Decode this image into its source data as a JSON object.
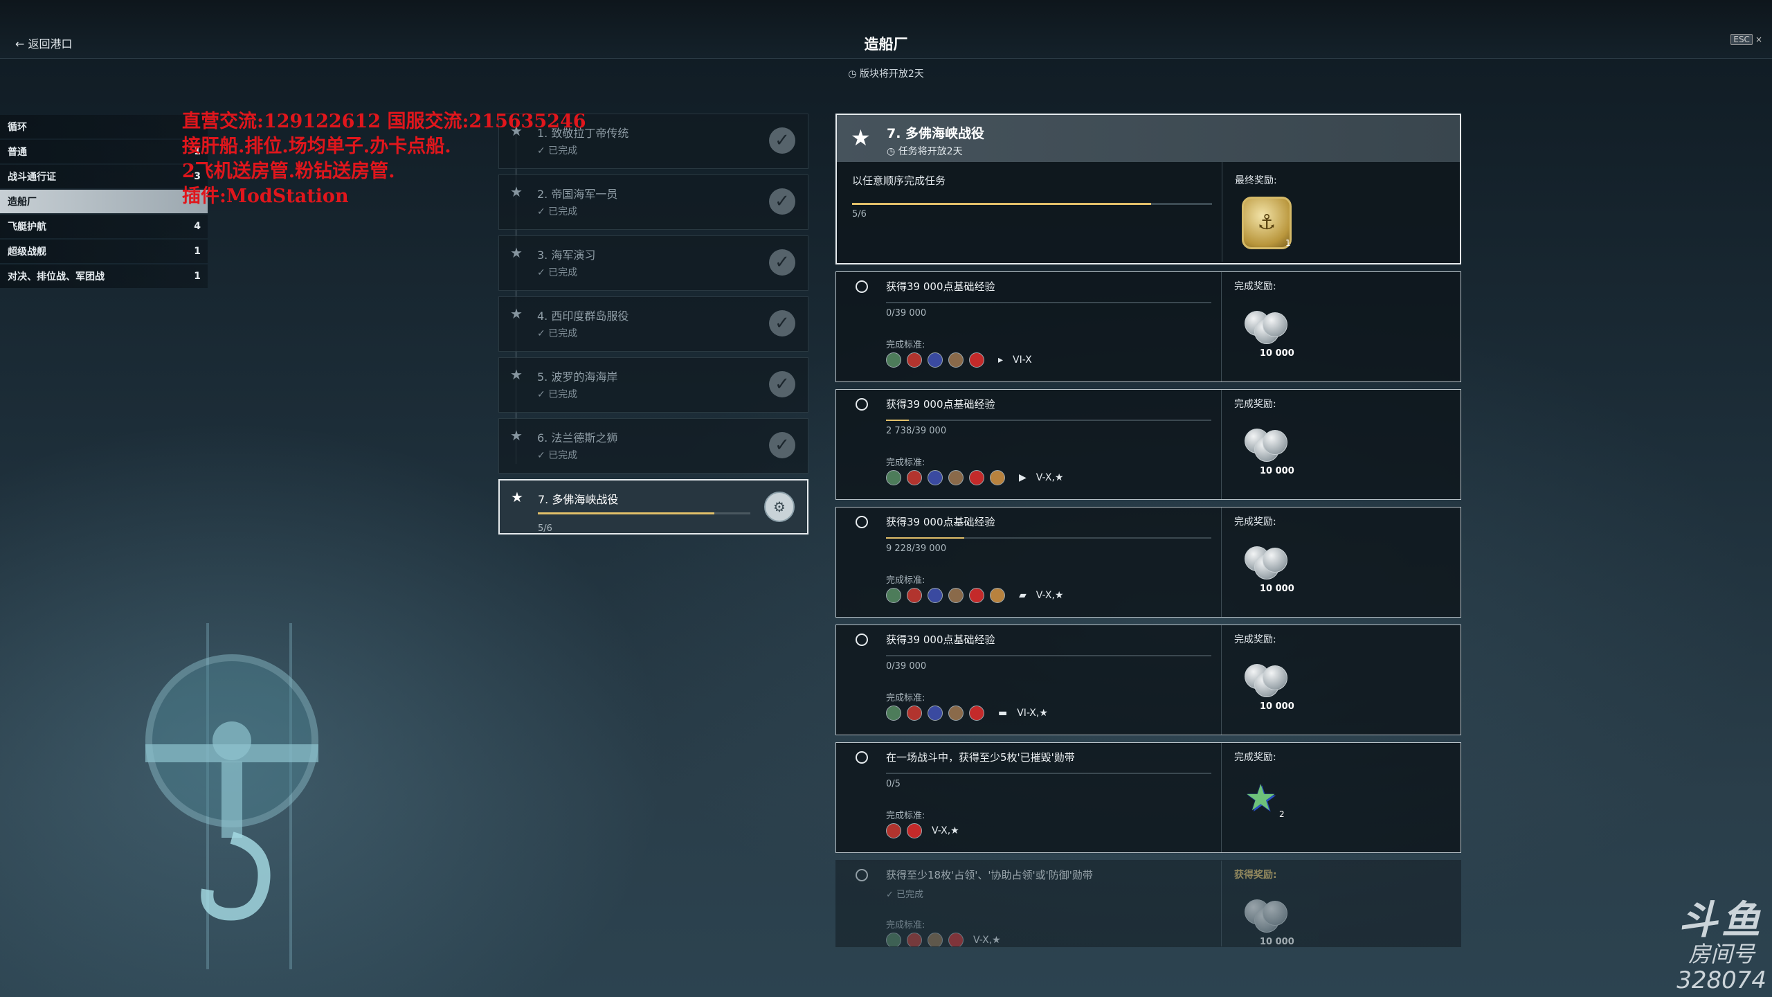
{
  "header": {
    "back_label": "← 返回港口",
    "title": "造船厂",
    "esc_key": "ESC",
    "close": "×",
    "timer": "◷ 版块将开放2天"
  },
  "sidebar": {
    "items": [
      {
        "label": "循环",
        "count": ""
      },
      {
        "label": "普通",
        "count": "1"
      },
      {
        "label": "战斗通行证",
        "count": "3"
      },
      {
        "label": "造船厂",
        "count": ""
      },
      {
        "label": "飞艇护航",
        "count": "4"
      },
      {
        "label": "超级战舰",
        "count": "1"
      },
      {
        "label": "对决、排位战、军团战",
        "count": "1"
      }
    ]
  },
  "overlay_text": {
    "line1": "直营交流:129122612 国服交流:215635246",
    "line2": "接肝船.排位.场均单子.办卡点船.",
    "line3": "2飞机送房管.粉钻送房管.",
    "line4": "插件:ModStation"
  },
  "stages": [
    {
      "name": "1. 致敬拉丁帝传统",
      "status": "✓ 已完成"
    },
    {
      "name": "2. 帝国海军一员",
      "status": "✓ 已完成"
    },
    {
      "name": "3. 海军演习",
      "status": "✓ 已完成"
    },
    {
      "name": "4. 西印度群岛服役",
      "status": "✓ 已完成"
    },
    {
      "name": "5. 波罗的海海岸",
      "status": "✓ 已完成"
    },
    {
      "name": "6. 法兰德斯之狮",
      "status": "✓ 已完成"
    },
    {
      "name": "7. 多佛海峡战役",
      "progress": "5/6",
      "fraction": 0.83
    }
  ],
  "detail": {
    "title": "7. 多佛海峡战役",
    "subtitle": "◷ 任务将开放2天",
    "instruction": "以任意顺序完成任务",
    "progress": "5/6",
    "fraction": 0.83,
    "reward_label": "最终奖励:",
    "final_reward_count": "1"
  },
  "tasks": [
    {
      "name": "获得39 000点基础经验",
      "progress": "0/39 000",
      "fraction": 0.0,
      "criteria_label": "完成标准:",
      "tier": "VI-X",
      "reward_label": "完成奖励:",
      "reward_qty": "10 000"
    },
    {
      "name": "获得39 000点基础经验",
      "progress": "2 738/39 000",
      "fraction": 0.07,
      "criteria_label": "完成标准:",
      "tier": "V-X,★",
      "reward_label": "完成奖励:",
      "reward_qty": "10 000"
    },
    {
      "name": "获得39 000点基础经验",
      "progress": "9 228/39 000",
      "fraction": 0.24,
      "criteria_label": "完成标准:",
      "tier": "V-X,★",
      "reward_label": "完成奖励:",
      "reward_qty": "10 000"
    },
    {
      "name": "获得39 000点基础经验",
      "progress": "0/39 000",
      "fraction": 0.0,
      "criteria_label": "完成标准:",
      "tier": "VI-X,★",
      "reward_label": "完成奖励:",
      "reward_qty": "10 000"
    },
    {
      "name": "在一场战斗中，获得至少5枚'已摧毁'勋带",
      "progress": "0/5",
      "fraction": 0.0,
      "criteria_label": "完成标准:",
      "tier": "V-X,★",
      "reward_label": "完成奖励:",
      "reward_qty": "2"
    },
    {
      "name": "获得至少18枚'占领'、'协助占领'或'防御'勋带",
      "status": "✓ 已完成",
      "criteria_label": "完成标准:",
      "tier": "V-X,★",
      "reward_label": "获得奖励:",
      "reward_qty": "10 000"
    }
  ],
  "watermark": {
    "logo": "斗鱼",
    "room_label": "房间号",
    "room_number": "328074"
  },
  "colors": {
    "accent": "#e2c06a",
    "overlay_red": "#e0161c",
    "panel": "#0e161c"
  }
}
